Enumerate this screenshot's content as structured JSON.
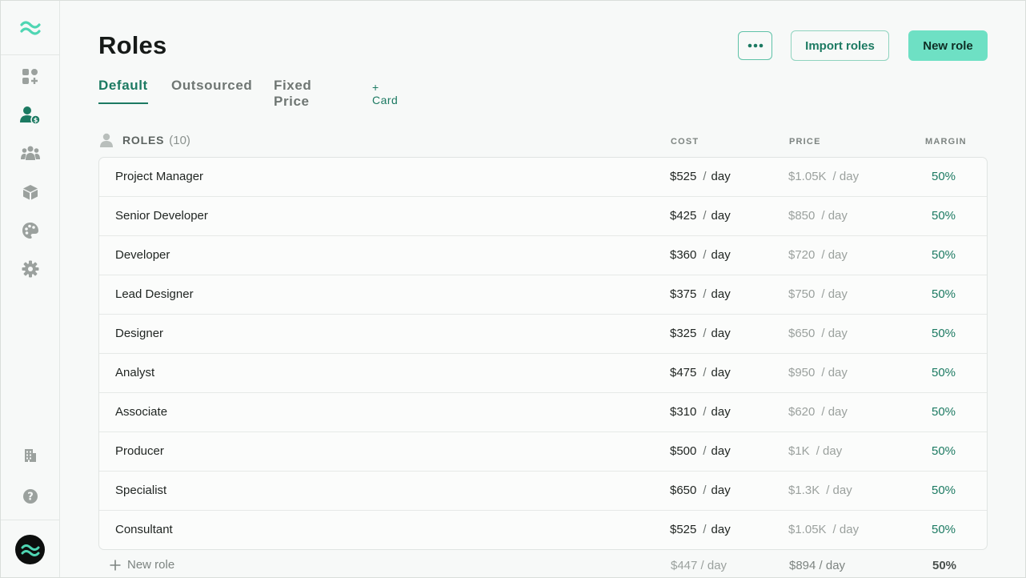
{
  "page": {
    "title": "Roles"
  },
  "header": {
    "import_label": "Import roles",
    "new_label": "New role"
  },
  "tabs": [
    {
      "label": "Default",
      "active": true
    },
    {
      "label": "Outsourced",
      "active": false
    },
    {
      "label": "Fixed Price",
      "active": false
    }
  ],
  "add_card_label": "+ Card",
  "table": {
    "roles_label": "ROLES",
    "count": "(10)",
    "columns": {
      "cost": "COST",
      "price": "PRICE",
      "margin": "MARGIN"
    },
    "rows": [
      {
        "name": "Project Manager",
        "cost": "$525",
        "cost_sep": "/",
        "cost_unit": "day",
        "price": "$1.05K",
        "price_unit": "/ day",
        "margin": "50%"
      },
      {
        "name": "Senior Developer",
        "cost": "$425",
        "cost_sep": "/",
        "cost_unit": "day",
        "price": "$850",
        "price_unit": "/ day",
        "margin": "50%"
      },
      {
        "name": "Developer",
        "cost": "$360",
        "cost_sep": "/",
        "cost_unit": "day",
        "price": "$720",
        "price_unit": "/ day",
        "margin": "50%"
      },
      {
        "name": "Lead Designer",
        "cost": "$375",
        "cost_sep": "/",
        "cost_unit": "day",
        "price": "$750",
        "price_unit": "/ day",
        "margin": "50%"
      },
      {
        "name": "Designer",
        "cost": "$325",
        "cost_sep": "/",
        "cost_unit": "day",
        "price": "$650",
        "price_unit": "/ day",
        "margin": "50%"
      },
      {
        "name": "Analyst",
        "cost": "$475",
        "cost_sep": "/",
        "cost_unit": "day",
        "price": "$950",
        "price_unit": "/ day",
        "margin": "50%"
      },
      {
        "name": "Associate",
        "cost": "$310",
        "cost_sep": "/",
        "cost_unit": "day",
        "price": "$620",
        "price_unit": "/ day",
        "margin": "50%"
      },
      {
        "name": "Producer",
        "cost": "$500",
        "cost_sep": "/",
        "cost_unit": "day",
        "price": "$1K",
        "price_unit": "/ day",
        "margin": "50%"
      },
      {
        "name": "Specialist",
        "cost": "$650",
        "cost_sep": "/",
        "cost_unit": "day",
        "price": "$1.3K",
        "price_unit": "/ day",
        "margin": "50%"
      },
      {
        "name": "Consultant",
        "cost": "$525",
        "cost_sep": "/",
        "cost_unit": "day",
        "price": "$1.05K",
        "price_unit": "/ day",
        "margin": "50%"
      }
    ]
  },
  "footer": {
    "add_label": "New role",
    "avg_cost": "$447 / day",
    "avg_price": "$894 / day",
    "avg_margin": "50%"
  },
  "colors": {
    "accent": "#1c7a62",
    "primary_button": "#6ee0c4",
    "border": "#e0e4e2"
  },
  "icons": {
    "sidebar_top": [
      "logo-waves-icon",
      "dashboard-add-icon",
      "roles-user-dollar-icon",
      "team-group-icon",
      "products-cube-icon",
      "palette-icon",
      "settings-gear-icon"
    ],
    "sidebar_bottom": [
      "company-building-icon",
      "help-question-icon",
      "account-avatar-icon"
    ]
  }
}
